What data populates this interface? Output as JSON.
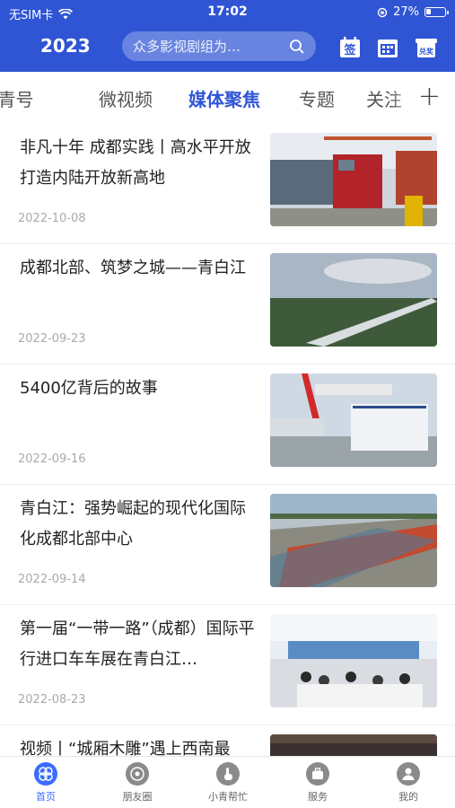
{
  "status_bar": {
    "carrier": "无SIM卡",
    "time": "17:02",
    "battery": "27%",
    "battery_level": 0.27
  },
  "header": {
    "year": "2023",
    "search_placeholder": "众多影视剧组为…",
    "icons": [
      "sign-in-icon",
      "calendar-icon",
      "redeem-icon"
    ],
    "sign_label": "签",
    "redeem_label": "兑奖"
  },
  "tabs": {
    "items": [
      "i青号",
      "微视频",
      "媒体聚焦",
      "专题",
      "关注"
    ],
    "active": "媒体聚焦",
    "add_label": "+"
  },
  "articles": [
    {
      "title": "非凡十年 成都实践丨高水平开放 打造内陆开放新高地",
      "date": "2022-10-08"
    },
    {
      "title": "成都北部、筑梦之城——青白江",
      "date": "2022-09-23"
    },
    {
      "title": "5400亿背后的故事",
      "date": "2022-09-16"
    },
    {
      "title": "青白江：强势崛起的现代化国际化成都北部中心",
      "date": "2022-09-14"
    },
    {
      "title": "第一届“一带一路”（成都）国际平行进口车车展在青白江…",
      "date": "2022-08-23"
    },
    {
      "title": "视频丨“城厢木雕”遇上西南最",
      "date": ""
    }
  ],
  "bottom_nav": [
    {
      "label": "首页",
      "icon": "home-icon",
      "active": true
    },
    {
      "label": "朋友圈",
      "icon": "friends-circle-icon",
      "active": false
    },
    {
      "label": "小青帮忙",
      "icon": "help-hand-icon",
      "active": false
    },
    {
      "label": "服务",
      "icon": "service-briefcase-icon",
      "active": false
    },
    {
      "label": "我的",
      "icon": "profile-icon",
      "active": false
    }
  ],
  "colors": {
    "brand": "#2f55d4",
    "accent": "#3b6cff"
  }
}
